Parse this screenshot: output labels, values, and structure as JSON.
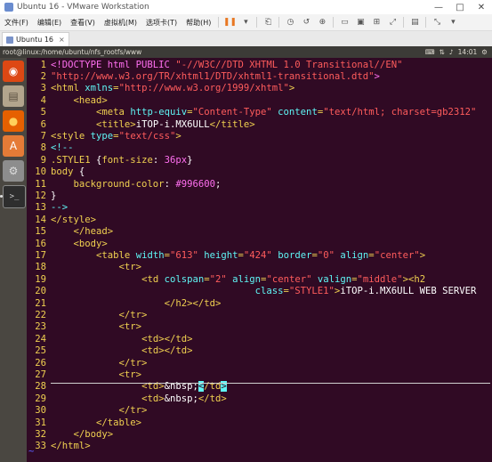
{
  "window": {
    "title": "Ubuntu 16 - VMware Workstation",
    "controls": [
      "—",
      "□",
      "✕"
    ]
  },
  "menubar": {
    "items": [
      "文件(F)",
      "编辑(E)",
      "查看(V)",
      "虚拟机(M)",
      "选项卡(T)",
      "帮助(H)"
    ]
  },
  "tab": {
    "label": "Ubuntu 16",
    "close": "×"
  },
  "panel": {
    "path": "root@linux:/home/ubuntu/nfs_rootfs/www",
    "time": "14:01"
  },
  "launcher": {
    "items": [
      "dash-icon",
      "files-icon",
      "firefox-icon",
      "software-center-icon",
      "settings-icon",
      "terminal-icon"
    ]
  },
  "editor": {
    "lines": [
      {
        "n": "1",
        "parts": [
          [
            "k",
            "<!DOCTYPE html PUBLIC "
          ],
          [
            "s",
            "\"-//W3C//DTD XHTML 1.0 Transitional//EN\""
          ]
        ]
      },
      {
        "n": "2",
        "parts": [
          [
            "s",
            "\"http://www.w3.org/TR/xhtml1/DTD/xhtml1-transitional.dtd\""
          ],
          [
            "k",
            ">"
          ]
        ]
      },
      {
        "n": "3",
        "parts": [
          [
            "t",
            "<html "
          ],
          [
            "a",
            "xmlns"
          ],
          [
            "t",
            "="
          ],
          [
            "s",
            "\"http://www.w3.org/1999/xhtml\""
          ],
          [
            "t",
            ">"
          ]
        ]
      },
      {
        "n": "4",
        "parts": [
          [
            "w",
            "    "
          ],
          [
            "t",
            "<head>"
          ]
        ]
      },
      {
        "n": "5",
        "parts": [
          [
            "w",
            "        "
          ],
          [
            "t",
            "<meta "
          ],
          [
            "a",
            "http-equiv"
          ],
          [
            "t",
            "="
          ],
          [
            "s",
            "\"Content-Type\""
          ],
          [
            "t",
            " "
          ],
          [
            "a",
            "content"
          ],
          [
            "t",
            "="
          ],
          [
            "s",
            "\"text/html; charset=gb2312\""
          ]
        ]
      },
      {
        "n": "6",
        "parts": [
          [
            "w",
            "        "
          ],
          [
            "t",
            "<title>"
          ],
          [
            "w",
            "iTOP-i.MX6ULL"
          ],
          [
            "t",
            "</title>"
          ]
        ]
      },
      {
        "n": "7",
        "parts": [
          [
            "t",
            "<style "
          ],
          [
            "a",
            "type"
          ],
          [
            "t",
            "="
          ],
          [
            "s",
            "\"text/css\""
          ],
          [
            "t",
            ">"
          ]
        ]
      },
      {
        "n": "8",
        "parts": [
          [
            "bl",
            "<!--"
          ]
        ]
      },
      {
        "n": "9",
        "parts": [
          [
            "t",
            ".STYLE1 "
          ],
          [
            "w",
            "{"
          ],
          [
            "t",
            "font-size"
          ],
          [
            "w",
            ": "
          ],
          [
            "k",
            "36px"
          ],
          [
            "w",
            "}"
          ]
        ]
      },
      {
        "n": "10",
        "parts": [
          [
            "t",
            "body "
          ],
          [
            "w",
            "{"
          ]
        ]
      },
      {
        "n": "11",
        "parts": [
          [
            "w",
            "    "
          ],
          [
            "t",
            "background-color"
          ],
          [
            "w",
            ": "
          ],
          [
            "k",
            "#996600"
          ],
          [
            "w",
            ";"
          ]
        ]
      },
      {
        "n": "12",
        "parts": [
          [
            "w",
            "}"
          ]
        ]
      },
      {
        "n": "13",
        "parts": [
          [
            "bl",
            "-->"
          ]
        ]
      },
      {
        "n": "14",
        "parts": [
          [
            "t",
            "</style>"
          ]
        ]
      },
      {
        "n": "15",
        "parts": [
          [
            "w",
            "    "
          ],
          [
            "t",
            "</head>"
          ]
        ]
      },
      {
        "n": "16",
        "parts": [
          [
            "w",
            "    "
          ],
          [
            "t",
            "<body>"
          ]
        ]
      },
      {
        "n": "17",
        "parts": [
          [
            "w",
            "        "
          ],
          [
            "t",
            "<table "
          ],
          [
            "a",
            "width"
          ],
          [
            "t",
            "="
          ],
          [
            "s",
            "\"613\""
          ],
          [
            "t",
            " "
          ],
          [
            "a",
            "height"
          ],
          [
            "t",
            "="
          ],
          [
            "s",
            "\"424\""
          ],
          [
            "t",
            " "
          ],
          [
            "a",
            "border"
          ],
          [
            "t",
            "="
          ],
          [
            "s",
            "\"0\""
          ],
          [
            "t",
            " "
          ],
          [
            "a",
            "align"
          ],
          [
            "t",
            "="
          ],
          [
            "s",
            "\"center\""
          ],
          [
            "t",
            ">"
          ]
        ]
      },
      {
        "n": "18",
        "parts": [
          [
            "w",
            "            "
          ],
          [
            "t",
            "<tr>"
          ]
        ]
      },
      {
        "n": "19",
        "parts": [
          [
            "w",
            "                "
          ],
          [
            "t",
            "<td "
          ],
          [
            "a",
            "colspan"
          ],
          [
            "t",
            "="
          ],
          [
            "s",
            "\"2\""
          ],
          [
            "t",
            " "
          ],
          [
            "a",
            "align"
          ],
          [
            "t",
            "="
          ],
          [
            "s",
            "\"center\""
          ],
          [
            "t",
            " "
          ],
          [
            "a",
            "valign"
          ],
          [
            "t",
            "="
          ],
          [
            "s",
            "\"middle\""
          ],
          [
            "t",
            "><h2"
          ]
        ]
      },
      {
        "n": "20",
        "parts": [
          [
            "w",
            "                                    "
          ],
          [
            "a",
            "class"
          ],
          [
            "t",
            "="
          ],
          [
            "s",
            "\"STYLE1\""
          ],
          [
            "t",
            ">"
          ],
          [
            "w",
            "iTOP-i.MX6ULL WEB SERVER"
          ]
        ]
      },
      {
        "n": "21",
        "parts": [
          [
            "w",
            "                    "
          ],
          [
            "t",
            "</h2></td>"
          ]
        ]
      },
      {
        "n": "22",
        "parts": [
          [
            "w",
            "            "
          ],
          [
            "t",
            "</tr>"
          ]
        ]
      },
      {
        "n": "23",
        "parts": [
          [
            "w",
            "            "
          ],
          [
            "t",
            "<tr>"
          ]
        ]
      },
      {
        "n": "24",
        "parts": [
          [
            "w",
            "                "
          ],
          [
            "t",
            "<td></td>"
          ]
        ]
      },
      {
        "n": "25",
        "parts": [
          [
            "w",
            "                "
          ],
          [
            "t",
            "<td></td>"
          ]
        ]
      },
      {
        "n": "26",
        "parts": [
          [
            "w",
            "            "
          ],
          [
            "t",
            "</tr>"
          ]
        ]
      },
      {
        "n": "27",
        "parts": [
          [
            "w",
            "            "
          ],
          [
            "t",
            "<tr>"
          ]
        ]
      },
      {
        "n": "28",
        "parts": [
          [
            "w",
            "                "
          ],
          [
            "t",
            "<td>"
          ],
          [
            "ent",
            "&nbsp;"
          ],
          [
            "hl",
            "<"
          ],
          [
            "t",
            "/td"
          ],
          [
            "hl",
            ">"
          ]
        ]
      },
      {
        "n": "29",
        "parts": [
          [
            "w",
            "                "
          ],
          [
            "t",
            "<td>"
          ],
          [
            "ent",
            "&nbsp;"
          ],
          [
            "t",
            "</td>"
          ]
        ]
      },
      {
        "n": "30",
        "parts": [
          [
            "w",
            "            "
          ],
          [
            "t",
            "</tr>"
          ]
        ]
      },
      {
        "n": "31",
        "parts": [
          [
            "w",
            "        "
          ],
          [
            "t",
            "</table>"
          ]
        ]
      },
      {
        "n": "32",
        "parts": [
          [
            "w",
            "    "
          ],
          [
            "t",
            "</body>"
          ]
        ]
      },
      {
        "n": "33",
        "parts": [
          [
            "t",
            "</html>"
          ]
        ]
      }
    ],
    "tilde": "~"
  }
}
